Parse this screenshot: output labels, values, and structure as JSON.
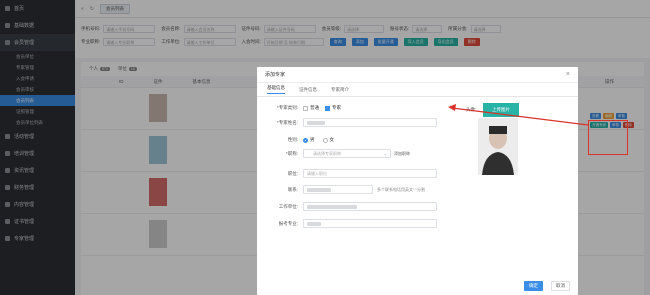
{
  "sidebar": {
    "items": [
      {
        "label": "首页"
      },
      {
        "label": "基础数据"
      },
      {
        "label": "会员管理"
      }
    ],
    "subitems": [
      {
        "label": "会员单位"
      },
      {
        "label": "专家管理"
      },
      {
        "label": "入会申请"
      },
      {
        "label": "会员审核"
      },
      {
        "label": "会员列表"
      },
      {
        "label": "证照管理"
      },
      {
        "label": "会员单位列表"
      }
    ],
    "lower": [
      {
        "label": "活动管理"
      },
      {
        "label": "培训管理"
      },
      {
        "label": "资讯管理"
      },
      {
        "label": "财务管理"
      },
      {
        "label": "内容管理"
      },
      {
        "label": "证书管理"
      },
      {
        "label": "专家管理"
      }
    ]
  },
  "topbar": {
    "tab": "会员列表"
  },
  "search": {
    "row1": [
      {
        "label": "手机号码:",
        "placeholder": "请输入手机号码"
      },
      {
        "label": "会员名称:",
        "placeholder": "请输入会员名称"
      },
      {
        "label": "证件号码:",
        "placeholder": "请输入证件号码"
      },
      {
        "label": "会员等级:",
        "placeholder": "请选择"
      },
      {
        "label": "账号状态:",
        "placeholder": "请选择"
      },
      {
        "label": "所属分会:",
        "placeholder": "请选择"
      }
    ],
    "row2": [
      {
        "label": "专业职称:",
        "placeholder": "请输入专业职称"
      },
      {
        "label": "工作单位:",
        "placeholder": "请输入工作单位"
      },
      {
        "label": "入会时间:",
        "placeholder": "开始日期 至 结束日期"
      }
    ],
    "buttons": [
      {
        "label": "查询"
      },
      {
        "label": "添加"
      },
      {
        "label": "批量开通"
      },
      {
        "label": "导入会员"
      },
      {
        "label": "导出会员"
      },
      {
        "label": "删除"
      }
    ]
  },
  "list": {
    "tabs": [
      {
        "label": "个人",
        "count": "872"
      },
      {
        "label": "单位",
        "count": "18"
      }
    ],
    "headers": [
      "ID",
      "证件",
      "基本信息",
      "操作"
    ],
    "op_labels": [
      "查看",
      "编辑",
      "开通专家",
      "审核",
      "删除"
    ]
  },
  "modal": {
    "title": "添加专家",
    "close": "×",
    "tabs": [
      "基础信息",
      "证件信息",
      "专家简介"
    ],
    "fields": {
      "type_label": "*专家类别:",
      "type_opt1": "普通",
      "type_opt2": "专家",
      "name_label": "*专家姓名:",
      "gender_label": "性别:",
      "gender_male": "男",
      "gender_female": "女",
      "title_label": "*职称:",
      "title_placeholder": "请选择专家职称",
      "title_extra": "添加职称",
      "position_label": "职位:",
      "position_placeholder": "请输入职位",
      "phone_label": "联系:",
      "phone_hint": "多个联系电话用英文\",\"分割",
      "company_label": "工作单位:",
      "major_label": "报考专业:",
      "avatar_label": "头像:",
      "upload": "上传图片"
    },
    "confirm": "确定",
    "cancel": "取消"
  },
  "colors": {
    "accent": "#3a8ee6",
    "upload": "#27b3a6",
    "arrow": "#d9332b"
  }
}
